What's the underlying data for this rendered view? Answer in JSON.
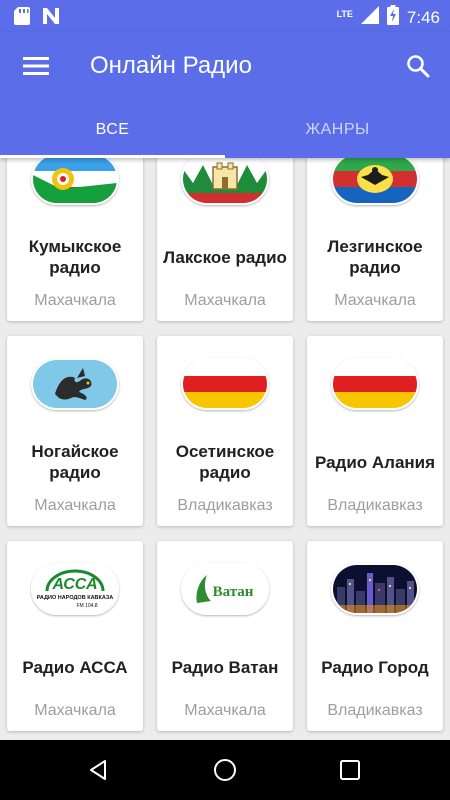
{
  "status_bar": {
    "time": "7:46",
    "network": "LTE",
    "icons": [
      "sd-card-icon",
      "n-notification-icon",
      "lte-signal-icon",
      "signal-icon",
      "battery-charging-icon"
    ]
  },
  "app_bar": {
    "title": "Онлайн Радио",
    "menu_icon": "hamburger-menu-icon",
    "search_icon": "search-icon",
    "color": "#5b6de9"
  },
  "tabs": [
    {
      "label": "ВСЕ",
      "selected": true
    },
    {
      "label": "ЖАНРЫ",
      "selected": false
    }
  ],
  "stations": [
    {
      "name": "Кумыкское радио",
      "city": "Махачкала",
      "logo": "kumyk-flag-logo"
    },
    {
      "name": "Лакское радио",
      "city": "Махачкала",
      "logo": "lak-emblem-logo"
    },
    {
      "name": "Лезгинское радио",
      "city": "Махачкала",
      "logo": "lezgin-eagle-logo"
    },
    {
      "name": "Ногайское радио",
      "city": "Махачкала",
      "logo": "nogai-dragon-logo"
    },
    {
      "name": "Осетинское радио",
      "city": "Владикавказ",
      "logo": "ossetia-flag-logo"
    },
    {
      "name": "Радио Алания",
      "city": "Владикавказ",
      "logo": "ossetia-flag-logo"
    },
    {
      "name": "Радио АССА",
      "city": "Махачкала",
      "logo": "assa-logo"
    },
    {
      "name": "Радио Ватан",
      "city": "Махачкала",
      "logo": "vatan-logo"
    },
    {
      "name": "Радио Город",
      "city": "Владикавказ",
      "logo": "night-city-logo"
    }
  ],
  "logo_text": {
    "assa_main": "АССА",
    "assa_arc": "РАДИО НАРОДОВ КАВКАЗА",
    "assa_freq": "FM 104.8",
    "vatan": "Ватан"
  },
  "nav_bar": {
    "icons": [
      "back-icon",
      "home-icon",
      "recents-icon"
    ]
  }
}
